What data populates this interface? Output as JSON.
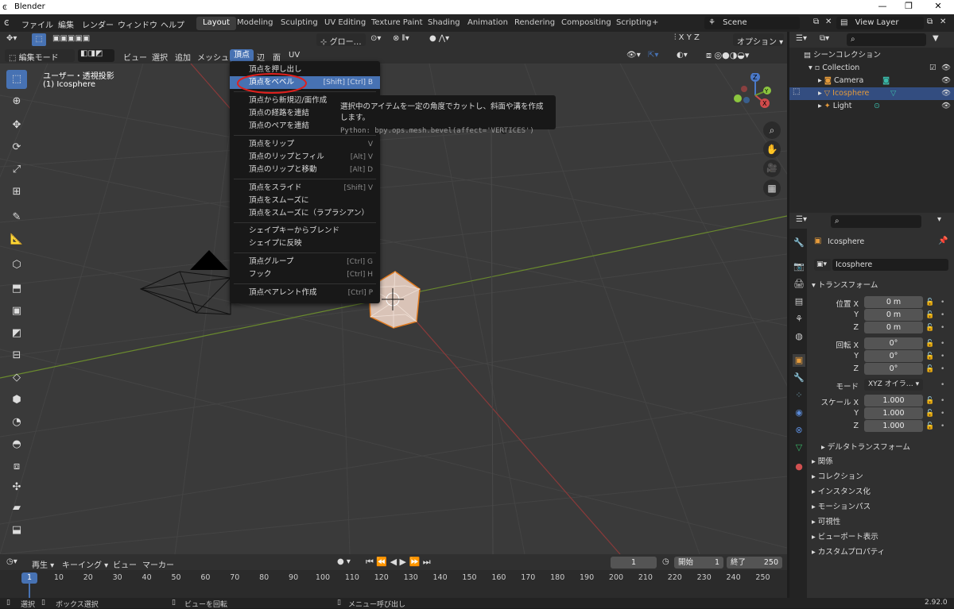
{
  "window": {
    "title": "Blender",
    "minimize": "—",
    "maximize": "❐",
    "close": "✕"
  },
  "menubar": {
    "items": [
      "ファイル",
      "編集",
      "レンダー",
      "ウィンドウ",
      "ヘルプ"
    ],
    "workspaces": [
      "Layout",
      "Modeling",
      "Sculpting",
      "UV Editing",
      "Texture Paint",
      "Shading",
      "Animation",
      "Rendering",
      "Compositing",
      "Scripting"
    ],
    "add_tab": "+",
    "scene": "Scene",
    "view_layer": "View Layer"
  },
  "toolheader": {
    "transform_orientation": "グロー…",
    "options": "オプション"
  },
  "viewport_header": {
    "mode": "編集モード",
    "menus": [
      "ビュー",
      "選択",
      "追加",
      "メッシュ",
      "頂点",
      "辺",
      "面",
      "UV"
    ],
    "active_menu": "頂点"
  },
  "viewport": {
    "view_name": "ユーザー・透視投影",
    "object_name": "(1) Icosphere"
  },
  "gizmo": {
    "x": "X",
    "y": "Y",
    "z": "Z"
  },
  "vertex_menu": {
    "items": [
      {
        "label": "頂点を押し出し",
        "shortcut": ""
      },
      {
        "label": "頂点をベベル",
        "shortcut": "[Shift] [Ctrl] B"
      },
      {
        "label": "頂点から新規辺/面作成",
        "shortcut": ""
      },
      {
        "label": "頂点の経路を連結",
        "shortcut": ""
      },
      {
        "label": "頂点のペアを連結",
        "shortcut": ""
      },
      {
        "label": "頂点をリップ",
        "shortcut": "V"
      },
      {
        "label": "頂点のリップとフィル",
        "shortcut": "[Alt] V"
      },
      {
        "label": "頂点のリップと移動",
        "shortcut": "[Alt] D"
      },
      {
        "label": "頂点をスライド",
        "shortcut": "[Shift] V"
      },
      {
        "label": "頂点をスムーズに",
        "shortcut": ""
      },
      {
        "label": "頂点をスムーズに（ラプラシアン）",
        "shortcut": ""
      },
      {
        "label": "シェイプキーからブレンド",
        "shortcut": ""
      },
      {
        "label": "シェイプに反映",
        "shortcut": ""
      },
      {
        "label": "頂点グループ",
        "shortcut": "[Ctrl] G"
      },
      {
        "label": "フック",
        "shortcut": "[Ctrl] H"
      },
      {
        "label": "頂点ペアレント作成",
        "shortcut": "[Ctrl] P"
      }
    ]
  },
  "tooltip": {
    "text": "選択中のアイテムを一定の角度でカットし、斜面や溝を作成します。",
    "python": "Python: bpy.ops.mesh.bevel(affect='VERTICES')"
  },
  "outliner": {
    "root": "シーンコレクション",
    "collection": "Collection",
    "objects": [
      "Camera",
      "Icosphere",
      "Light"
    ]
  },
  "properties": {
    "object_name": "Icosphere",
    "data_name": "Icosphere",
    "transform": "トランスフォーム",
    "location_label": "位置 X",
    "rotation_label": "回転 X",
    "scale_label": "スケール X",
    "y": "Y",
    "z": "Z",
    "location": [
      "0 m",
      "0 m",
      "0 m"
    ],
    "rotation": [
      "0°",
      "0°",
      "0°"
    ],
    "mode_label": "モード",
    "mode": "XYZ オイラ…",
    "scale": [
      "1.000",
      "1.000",
      "1.000"
    ],
    "delta": "デルタトランスフォーム",
    "sections": [
      "関係",
      "コレクション",
      "インスタンス化",
      "モーションパス",
      "可視性",
      "ビューポート表示",
      "カスタムプロパティ"
    ]
  },
  "timeline": {
    "menus": [
      "再生",
      "キーイング",
      "ビュー",
      "マーカー"
    ],
    "current_frame": "1",
    "start_label": "開始",
    "start": "1",
    "end_label": "終了",
    "end": "250",
    "ticks": [
      "1",
      "10",
      "20",
      "30",
      "40",
      "50",
      "60",
      "70",
      "80",
      "90",
      "100",
      "110",
      "120",
      "130",
      "140",
      "150",
      "160",
      "170",
      "180",
      "190",
      "200",
      "210",
      "220",
      "230",
      "240",
      "250"
    ]
  },
  "statusbar": {
    "select": "選択",
    "box_select": "ボックス選択",
    "rotate_view": "ビューを回転",
    "menu": "メニュー呼び出し",
    "version": "2.92.0"
  }
}
